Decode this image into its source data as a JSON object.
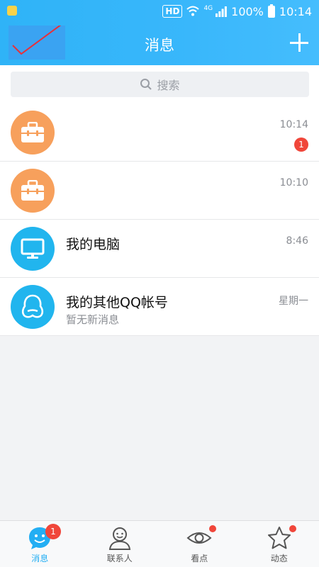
{
  "statusbar": {
    "hd": "HD",
    "network": "4G",
    "battery": "100%",
    "time": "10:14"
  },
  "header": {
    "title": "消息"
  },
  "search": {
    "placeholder": "搜索"
  },
  "conversations": [
    {
      "name": "",
      "preview": "",
      "time": "10:14",
      "badge": "1",
      "icon": "briefcase-icon"
    },
    {
      "name": "",
      "preview": "",
      "time": "10:10",
      "badge": "",
      "icon": "briefcase-icon"
    },
    {
      "name": "我的电脑",
      "preview": "",
      "time": "8:46",
      "badge": "",
      "icon": "monitor-icon"
    },
    {
      "name": "我的其他QQ帐号",
      "preview": "暂无新消息",
      "time": "星期一",
      "badge": "",
      "icon": "qq-penguin-icon"
    }
  ],
  "nav": [
    {
      "label": "消息",
      "badge": "1",
      "icon": "message-smile-icon",
      "active": true
    },
    {
      "label": "联系人",
      "badge": "",
      "icon": "contact-person-icon",
      "active": false
    },
    {
      "label": "看点",
      "badge": "",
      "icon": "eye-icon",
      "active": false
    },
    {
      "label": "动态",
      "badge": "",
      "icon": "star-icon",
      "active": false
    }
  ],
  "colors": {
    "header": "#39b7fb",
    "badge": "#f0463a",
    "orange_avatar": "#f7a05c",
    "blue_avatar": "#21b5ee",
    "active_tab": "#23aef3"
  }
}
